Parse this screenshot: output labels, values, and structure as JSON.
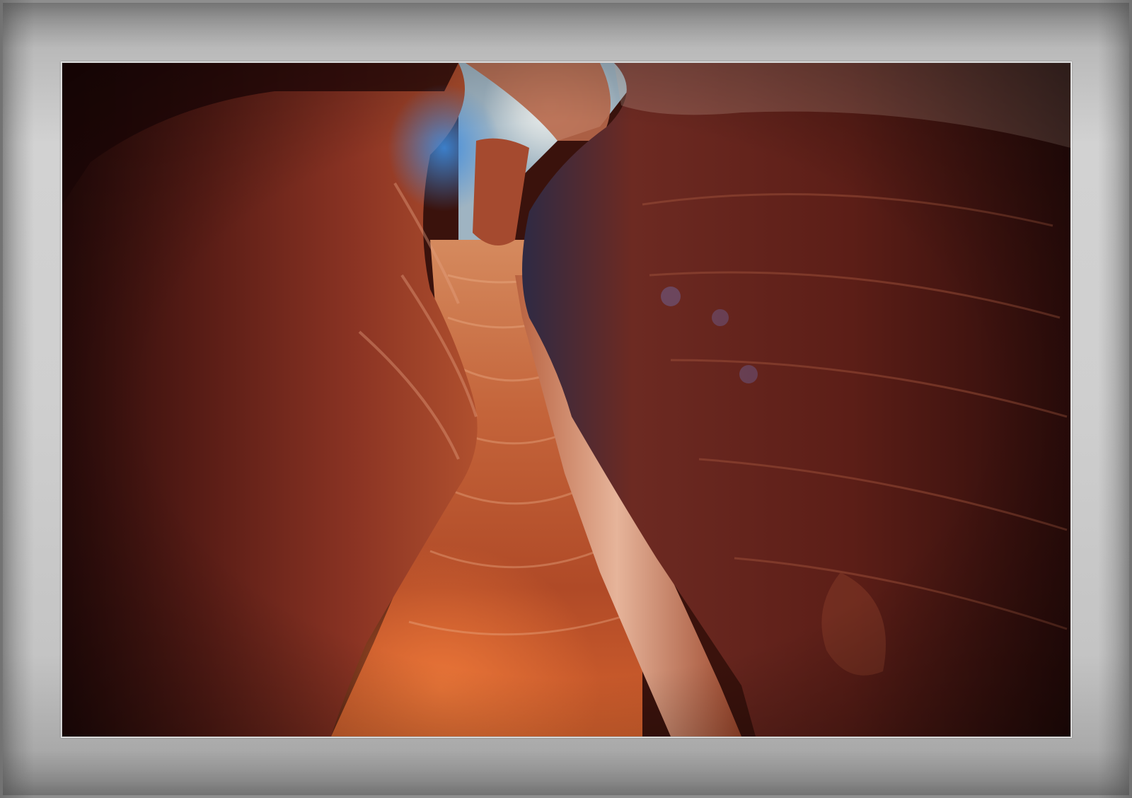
{
  "image": {
    "subject": "slot canyon",
    "palette": {
      "rock_dark": "#2a0c08",
      "rock_mid": "#7a2c1e",
      "rock_warm": "#c2532c",
      "rock_glow": "#e3743d",
      "sky": "#d8dfe0",
      "blue_glow": "#2f6fb8",
      "frame": "#c8c8c8"
    }
  }
}
